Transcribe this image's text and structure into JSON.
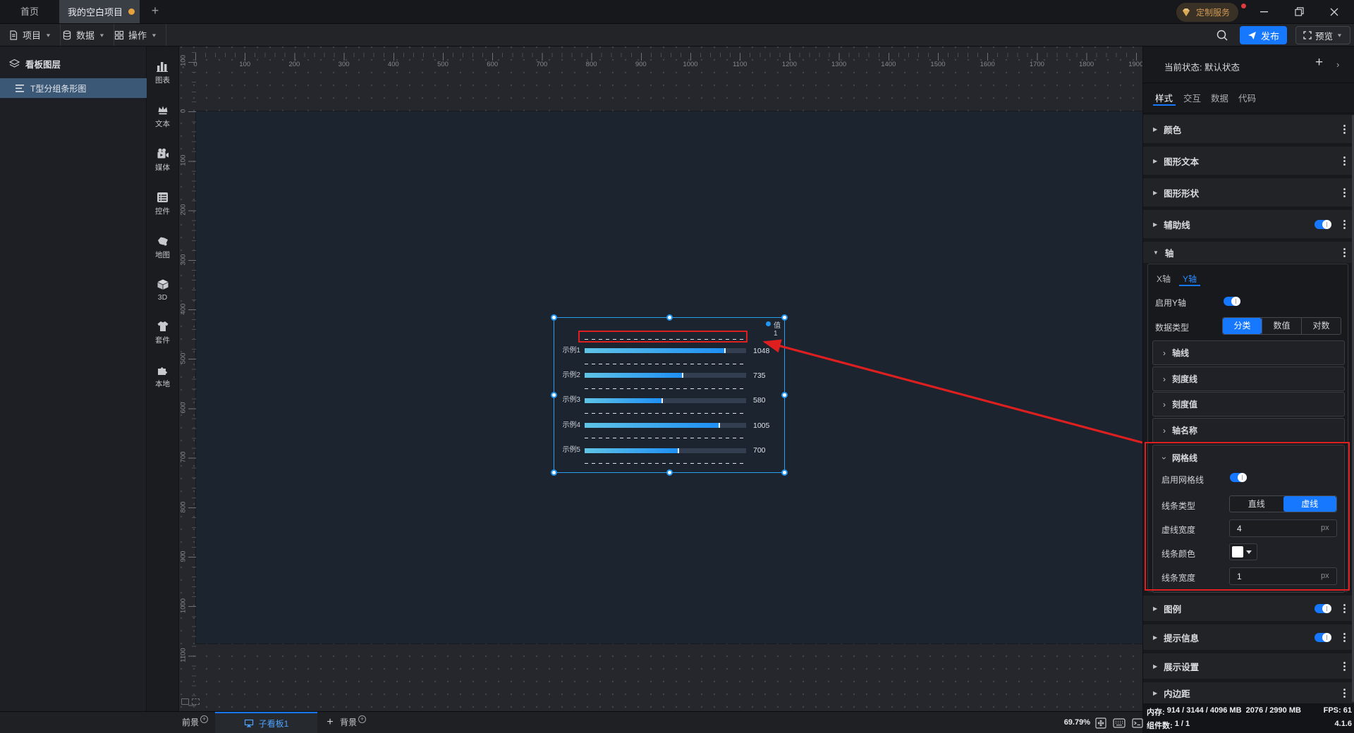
{
  "topbar": {
    "home": "首页",
    "project_tab": "我的空白项目",
    "add_tab": "+",
    "custom_service": "定制服务"
  },
  "menubar": {
    "menus": [
      {
        "icon": "document-icon",
        "label": "项目"
      },
      {
        "icon": "database-icon",
        "label": "数据"
      },
      {
        "icon": "layout-icon",
        "label": "操作"
      }
    ],
    "publish": "发布",
    "preview": "预览"
  },
  "layers": {
    "title": "看板图层",
    "selected_item": "T型分组条形图"
  },
  "dock": {
    "items": [
      "图表",
      "文本",
      "媒体",
      "控件",
      "地图",
      "3D",
      "套件",
      "本地"
    ]
  },
  "canvas": {
    "h_ruler": [
      "0",
      "100",
      "200",
      "300",
      "400",
      "500",
      "600",
      "700",
      "800",
      "900",
      "1000",
      "1100",
      "1200",
      "1300",
      "1400",
      "1500",
      "1600",
      "1700",
      "1800",
      "1900"
    ],
    "v_ruler": [
      "-100",
      "0",
      "100",
      "200",
      "300",
      "400",
      "500",
      "600",
      "700",
      "800",
      "900",
      "1000",
      "1100"
    ]
  },
  "chart_data": {
    "type": "bar",
    "orientation": "horizontal",
    "component_name": "T型分组条形图",
    "categories": [
      "示例1",
      "示例2",
      "示例3",
      "示例4",
      "示例5"
    ],
    "series": [
      {
        "name": "值1",
        "values": [
          1048,
          735,
          580,
          1005,
          700
        ]
      }
    ],
    "xlim": [
      0,
      1200
    ],
    "legend_position": "top-right",
    "grid": "dashed-horizontal"
  },
  "inspector": {
    "state_label": "当前状态:",
    "state_value": "默认状态",
    "tabs": [
      "样式",
      "交互",
      "数据",
      "代码"
    ],
    "active_tab": "样式",
    "sections": [
      {
        "label": "颜色"
      },
      {
        "label": "图形文本"
      },
      {
        "label": "图形形状"
      },
      {
        "label": "辅助线",
        "enabled": true
      },
      {
        "label": "轴",
        "expanded": true
      }
    ],
    "axis": {
      "tabs": [
        "X轴",
        "Y轴"
      ],
      "active_tab": "Y轴",
      "enable_label": "启用Y轴",
      "enabled": true,
      "datatype_label": "数据类型",
      "datatype_options": [
        "分类",
        "数值",
        "对数"
      ],
      "datatype_selected": "分类",
      "subsections": [
        "轴线",
        "刻度线",
        "刻度值",
        "轴名称"
      ],
      "gridline": {
        "title": "网格线",
        "enable_label": "启用网格线",
        "enabled": true,
        "line_type_label": "线条类型",
        "line_type_options": [
          "直线",
          "虚线"
        ],
        "line_type_selected": "虚线",
        "dash_width_label": "虚线宽度",
        "dash_width_value": "4",
        "dash_width_unit": "px",
        "line_color_label": "线条颜色",
        "line_color_value": "#ffffff",
        "line_width_label": "线条宽度",
        "line_width_value": "1",
        "line_width_unit": "px"
      }
    },
    "sections_bottom": [
      {
        "label": "图例",
        "enabled": true
      },
      {
        "label": "提示信息",
        "enabled": true
      },
      {
        "label": "展示设置"
      },
      {
        "label": "内边距"
      }
    ],
    "status": {
      "memory_label": "内存:",
      "memory_main": "914 / 3144 / 4096 MB",
      "memory_extra": "2076 / 2990 MB",
      "fps_label": "FPS:",
      "fps_value": "61",
      "components_label": "组件数:",
      "components_value": "1 / 1",
      "version": "4.1.6"
    }
  },
  "bottombar": {
    "foreground": "前景",
    "active_board": "子看板1",
    "add": "+",
    "background": "背景",
    "zoom_level": "69.79%"
  },
  "colors": {
    "accent": "#1677ff",
    "selection": "#2b9df0",
    "annotation_red": "#de1f1f",
    "bar_gradient_start": "#5fc4e6",
    "bar_gradient_end": "#1e8ff5",
    "bar_track": "#333e50",
    "unsaved_dot": "#e6a23c",
    "artboard_bg": "#1c2430"
  }
}
